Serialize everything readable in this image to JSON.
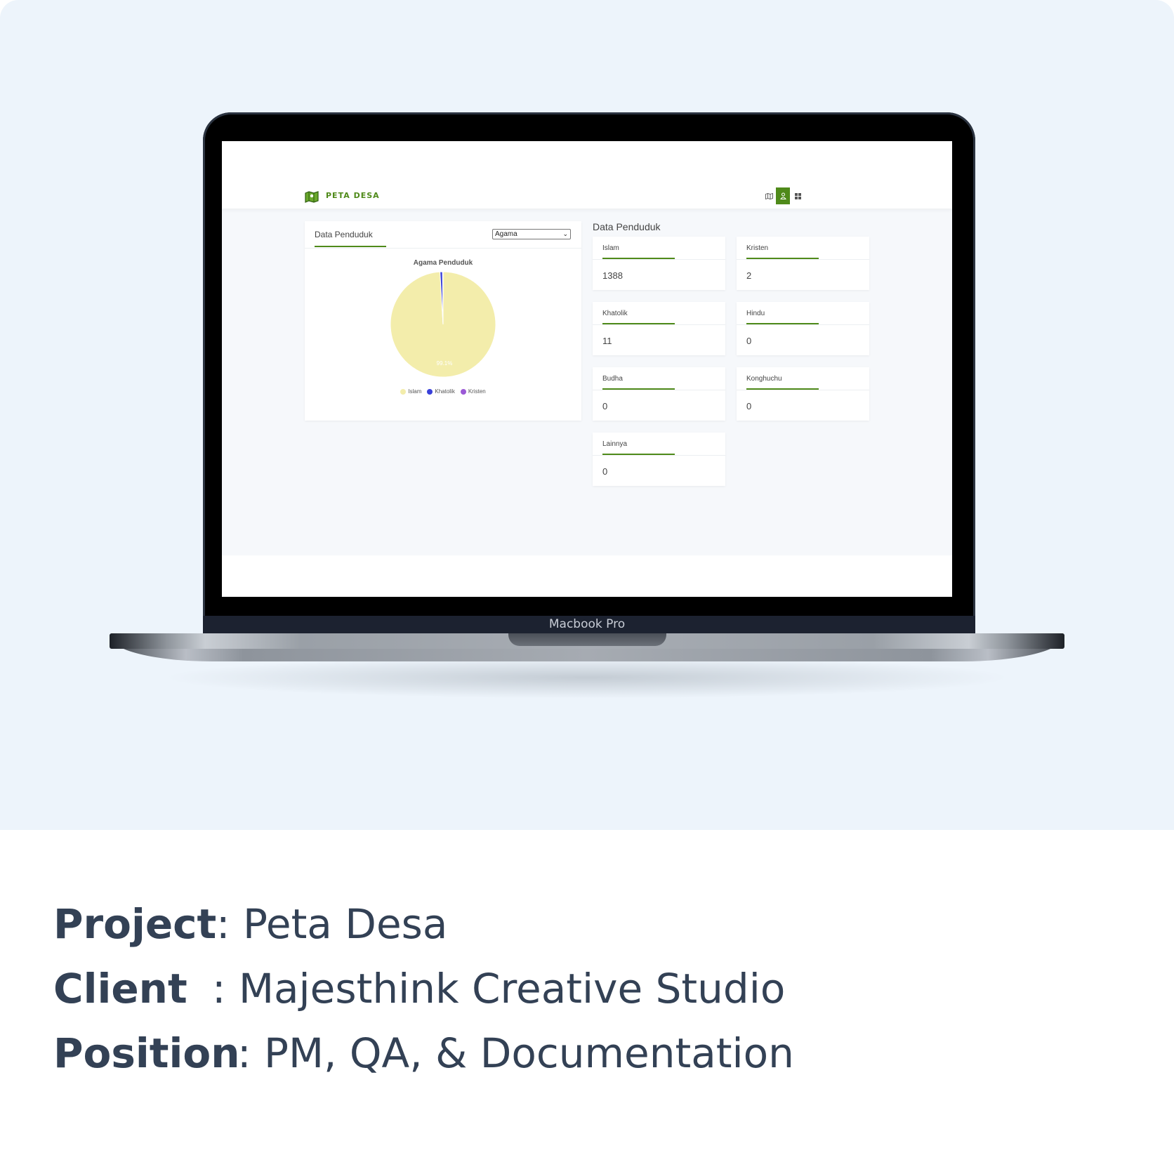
{
  "device": {
    "label": "Macbook Pro"
  },
  "app": {
    "brand": "PETA DESA",
    "nav": [
      {
        "name": "map-icon",
        "active": false
      },
      {
        "name": "user-icon",
        "active": true
      },
      {
        "name": "grid-icon",
        "active": false
      }
    ],
    "accent_color": "#4f8a1a"
  },
  "chart_card": {
    "title": "Data Penduduk",
    "select_value": "Agama"
  },
  "chart_data": {
    "type": "pie",
    "title": "Agama Penduduk",
    "categories": [
      "Islam",
      "Khatolik",
      "Kristen"
    ],
    "values": [
      1388,
      11,
      2
    ],
    "colors": [
      "#f3edab",
      "#3940d9",
      "#9b59d6"
    ],
    "data_label": "99.1%",
    "legend": "bottom"
  },
  "stats": {
    "title": "Data Penduduk",
    "items": [
      {
        "label": "Islam",
        "value": "1388"
      },
      {
        "label": "Kristen",
        "value": "2"
      },
      {
        "label": "Khatolik",
        "value": "11"
      },
      {
        "label": "Hindu",
        "value": "0"
      },
      {
        "label": "Budha",
        "value": "0"
      },
      {
        "label": "Konghuchu",
        "value": "0"
      },
      {
        "label": "Lainnya",
        "value": "0"
      }
    ]
  },
  "caption": {
    "project_label": "Project",
    "project_value": ": Peta Desa",
    "client_label": "Client",
    "client_value": ": Majesthink Creative Studio",
    "position_label": "Position",
    "position_value": ": PM, QA, & Documentation"
  }
}
